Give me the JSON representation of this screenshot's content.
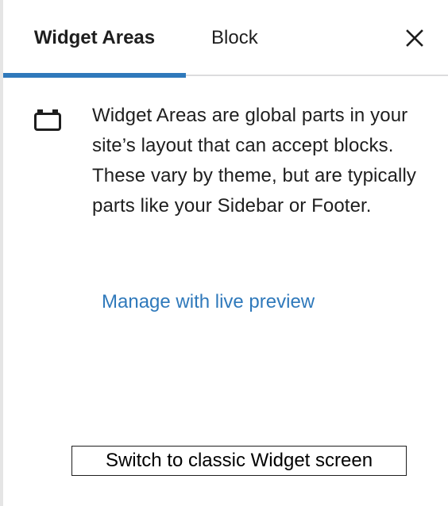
{
  "tabs": {
    "widget_areas": "Widget Areas",
    "block": "Block",
    "active": "widget_areas"
  },
  "close_icon": "close-icon",
  "info": {
    "icon": "block-default-icon",
    "description": "Widget Areas are global parts in your site’s layout that can accept blocks. These vary by theme, but are typically parts like your Sidebar or Footer.",
    "link_label": "Manage with live preview"
  },
  "footer": {
    "classic_button_label": "Switch to classic Widget screen"
  },
  "colors": {
    "accent": "#2f79bb",
    "text": "#1e1e1e",
    "divider": "#dcdcde"
  }
}
